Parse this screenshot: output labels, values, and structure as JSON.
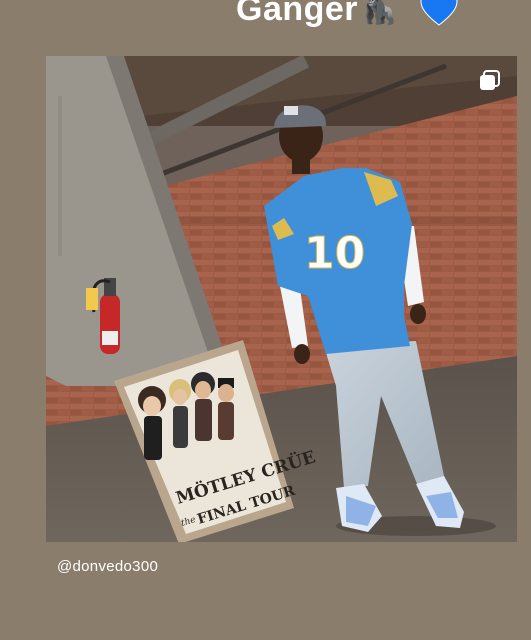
{
  "story": {
    "caption_text": "Ganger",
    "caption_emoji": "🦍",
    "heart_color": "#1877f2",
    "photo_tag": "@donvedo300"
  },
  "photo": {
    "jersey_number": "10",
    "poster": {
      "band": "MÖTLEY CRÜE",
      "subtitle_small": "the",
      "subtitle": "FINAL TOUR"
    }
  }
}
